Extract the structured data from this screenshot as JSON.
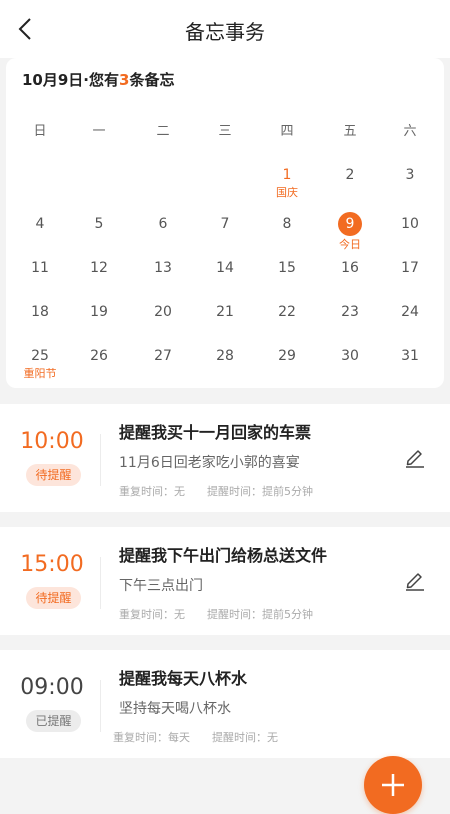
{
  "header": {
    "title": "备忘事务",
    "back_icon": "chevron-left-icon"
  },
  "calendar": {
    "summary": {
      "prefix": "10月9日·您有",
      "count": "3",
      "suffix": "条备忘"
    },
    "weekdays": [
      "日",
      "一",
      "二",
      "三",
      "四",
      "五",
      "六"
    ],
    "days": [
      {
        "day": "1",
        "col": 4,
        "row": 0,
        "note": "国庆",
        "holiday": true
      },
      {
        "day": "2",
        "col": 5,
        "row": 0
      },
      {
        "day": "3",
        "col": 6,
        "row": 0
      },
      {
        "day": "4",
        "col": 0,
        "row": 1
      },
      {
        "day": "5",
        "col": 1,
        "row": 1
      },
      {
        "day": "6",
        "col": 2,
        "row": 1
      },
      {
        "day": "7",
        "col": 3,
        "row": 1
      },
      {
        "day": "8",
        "col": 4,
        "row": 1
      },
      {
        "day": "9",
        "col": 5,
        "row": 1,
        "note": "今日",
        "today": true
      },
      {
        "day": "10",
        "col": 6,
        "row": 1
      },
      {
        "day": "11",
        "col": 0,
        "row": 2
      },
      {
        "day": "12",
        "col": 1,
        "row": 2
      },
      {
        "day": "13",
        "col": 2,
        "row": 2
      },
      {
        "day": "14",
        "col": 3,
        "row": 2
      },
      {
        "day": "15",
        "col": 4,
        "row": 2
      },
      {
        "day": "16",
        "col": 5,
        "row": 2
      },
      {
        "day": "17",
        "col": 6,
        "row": 2
      },
      {
        "day": "18",
        "col": 0,
        "row": 3
      },
      {
        "day": "19",
        "col": 1,
        "row": 3
      },
      {
        "day": "20",
        "col": 2,
        "row": 3
      },
      {
        "day": "21",
        "col": 3,
        "row": 3
      },
      {
        "day": "22",
        "col": 4,
        "row": 3
      },
      {
        "day": "23",
        "col": 5,
        "row": 3
      },
      {
        "day": "24",
        "col": 6,
        "row": 3
      },
      {
        "day": "25",
        "col": 0,
        "row": 4,
        "note": "重阳节"
      },
      {
        "day": "26",
        "col": 1,
        "row": 4
      },
      {
        "day": "27",
        "col": 2,
        "row": 4
      },
      {
        "day": "28",
        "col": 3,
        "row": 4
      },
      {
        "day": "29",
        "col": 4,
        "row": 4
      },
      {
        "day": "30",
        "col": 5,
        "row": 4
      },
      {
        "day": "31",
        "col": 6,
        "row": 4
      }
    ]
  },
  "reminders": [
    {
      "time": "10:00",
      "status": "待提醒",
      "done": false,
      "title": "提醒我买十一月回家的车票",
      "desc": "11月6日回老家吃小郭的喜宴",
      "repeat": "重复时间：无",
      "remind": "提醒时间：提前5分钟",
      "edit_icon": "pencil-icon"
    },
    {
      "time": "15:00",
      "status": "待提醒",
      "done": false,
      "title": "提醒我下午出门给杨总送文件",
      "desc": "下午三点出门",
      "repeat": "重复时间：无",
      "remind": "提醒时间：提前5分钟",
      "edit_icon": "pencil-icon"
    },
    {
      "time": "09:00",
      "status": "已提醒",
      "done": true,
      "title": "提醒我每天八杯水",
      "desc": "坚持每天喝八杯水",
      "repeat": "重复时间：每天",
      "remind": "提醒时间：无"
    }
  ],
  "fab": {
    "icon": "plus-icon"
  },
  "colors": {
    "accent": "#f26b21",
    "badge_pending_bg": "#fde5db",
    "badge_done_bg": "#ececec"
  }
}
